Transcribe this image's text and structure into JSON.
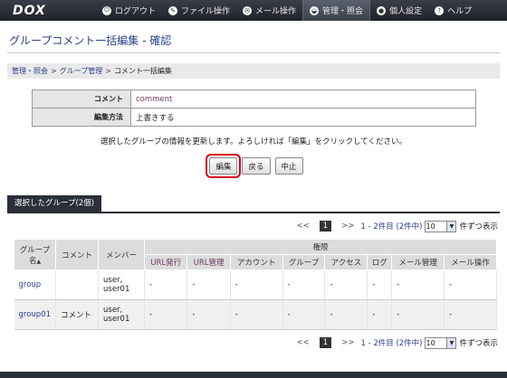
{
  "app": {
    "logo": "DOX"
  },
  "nav": [
    {
      "icon": "logout-icon",
      "glyph": "⏻",
      "label": "ログアウト"
    },
    {
      "icon": "file-icon",
      "glyph": "✎",
      "label": "ファイル操作"
    },
    {
      "icon": "mail-icon",
      "glyph": "✉",
      "label": "メール操作"
    },
    {
      "icon": "admin-icon",
      "glyph": "◒",
      "label": "管理・照会",
      "active": true
    },
    {
      "icon": "user-icon",
      "glyph": "●",
      "label": "個人設定"
    },
    {
      "icon": "help-icon",
      "glyph": "?",
      "label": "ヘルプ"
    }
  ],
  "page": {
    "title": "グループコメント一括編集 - 確認"
  },
  "breadcrumb": {
    "item1": "管理・照会",
    "item2": "グループ管理",
    "current": "コメント一括編集",
    "sep": ">"
  },
  "form": {
    "comment_label": "コメント",
    "comment_value": "comment",
    "method_label": "編集方法",
    "method_value": "上書きする"
  },
  "notice": "選択したグループの情報を更新します。よろしければ「編集」をクリックしてください。",
  "buttons": {
    "edit": "編集",
    "back": "戻る",
    "cancel": "中止"
  },
  "tab": {
    "label": "選択したグループ(2個)"
  },
  "pager": {
    "prev": "<<",
    "current": "1",
    "next": ">>",
    "range": "1 - 2件目 (2件中)",
    "per_page": "10",
    "suffix": "件ずつ表示"
  },
  "table": {
    "headers": {
      "group": "グループ名",
      "sort": "▲",
      "comment": "コメント",
      "member": "メンバー",
      "permission": "権限",
      "url_issue": "URL発行",
      "url_manage": "URL管理",
      "account": "アカウント",
      "group_perm": "グループ",
      "access": "アクセス",
      "log": "ログ",
      "mail_manage": "メール管理",
      "mail_op": "メール操作"
    },
    "rows": [
      {
        "name": "group",
        "comment": "",
        "member": "user, user01",
        "p1": "-",
        "p2": "-",
        "p3": "-",
        "p4": "-",
        "p5": "-",
        "p6": "-",
        "p7": "-",
        "p8": "-"
      },
      {
        "name": "group01",
        "comment": "コメント",
        "member": "user, user01",
        "p1": "-",
        "p2": "-",
        "p3": "-",
        "p4": "-",
        "p5": "-",
        "p6": "-",
        "p7": "-",
        "p8": "-"
      }
    ]
  }
}
